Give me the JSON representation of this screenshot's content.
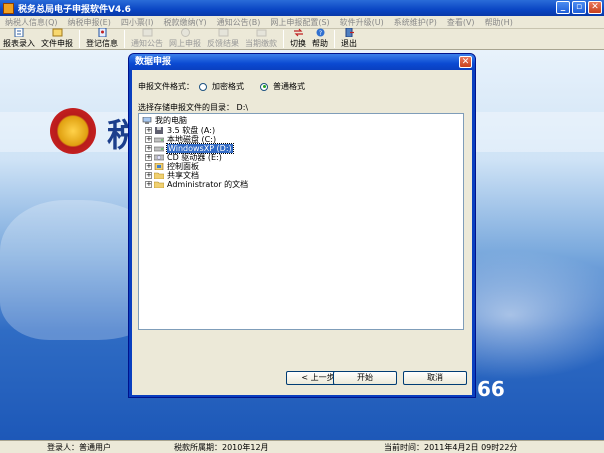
{
  "app": {
    "title": "税务总局电子申报软件V4.6",
    "window_buttons": [
      "_",
      "▫",
      "✕"
    ]
  },
  "menu": [
    "纳税人信息(Q)",
    "纳税申报(E)",
    "四小票(I)",
    "税款缴纳(Y)",
    "通知公告(B)",
    "网上申报配置(S)",
    "软件升级(U)",
    "系统维护(P)",
    "查看(V)",
    "帮助(H)"
  ],
  "toolbar": {
    "items": [
      {
        "label": "报表录入",
        "enabled": true
      },
      {
        "label": "文件申报",
        "enabled": true
      },
      {
        "label": "登记信息",
        "enabled": true
      },
      {
        "label": "通知公告",
        "enabled": false
      },
      {
        "label": "网上申报",
        "enabled": false
      },
      {
        "label": "反馈结果",
        "enabled": false
      },
      {
        "label": "当期缴款",
        "enabled": false
      },
      {
        "label": "切换",
        "enabled": true
      },
      {
        "label": "帮助",
        "enabled": true
      },
      {
        "label": "退出",
        "enabled": true
      }
    ]
  },
  "background": {
    "banner_text": "税",
    "phone_text": "66"
  },
  "dialog": {
    "title": "数据申报",
    "close_label": "✕",
    "format_label": "申报文件格式：",
    "format_options": [
      {
        "label": "加密格式",
        "selected": false
      },
      {
        "label": "普通格式",
        "selected": true
      }
    ],
    "dir_label": "选择存储申报文件的目录：",
    "dir_value": "D:\\",
    "tree": [
      {
        "label": "我的电脑",
        "icon": "computer-icon",
        "level": 0,
        "expandable": false,
        "selected": false
      },
      {
        "label": "3.5 软盘 (A:)",
        "icon": "floppy-icon",
        "level": 1,
        "expandable": true,
        "selected": false
      },
      {
        "label": "本地磁盘 (C:)",
        "icon": "disk-icon",
        "level": 1,
        "expandable": true,
        "selected": false
      },
      {
        "label": "WindowsXP (D:)",
        "icon": "disk-icon",
        "level": 1,
        "expandable": true,
        "selected": true
      },
      {
        "label": "CD 驱动器 (E:)",
        "icon": "cd-icon",
        "level": 1,
        "expandable": true,
        "selected": false
      },
      {
        "label": "控制面板",
        "icon": "control-panel-icon",
        "level": 1,
        "expandable": true,
        "selected": false
      },
      {
        "label": "共享文档",
        "icon": "folder-icon",
        "level": 1,
        "expandable": true,
        "selected": false
      },
      {
        "label": "Administrator 的文档",
        "icon": "folder-icon",
        "level": 1,
        "expandable": true,
        "selected": false
      }
    ],
    "buttons": {
      "prev": "< 上一步",
      "start": "开始",
      "cancel": "取消"
    }
  },
  "status": {
    "user_label": "登录人：普通用户",
    "period_label": "税款所属期：2010年12月",
    "time_label": "当前时间：2011年4月2日 09时22分"
  },
  "colors": {
    "title_blue": "#0a46c4",
    "selection": "#316ac5",
    "dialog_face": "#ece9d8"
  }
}
